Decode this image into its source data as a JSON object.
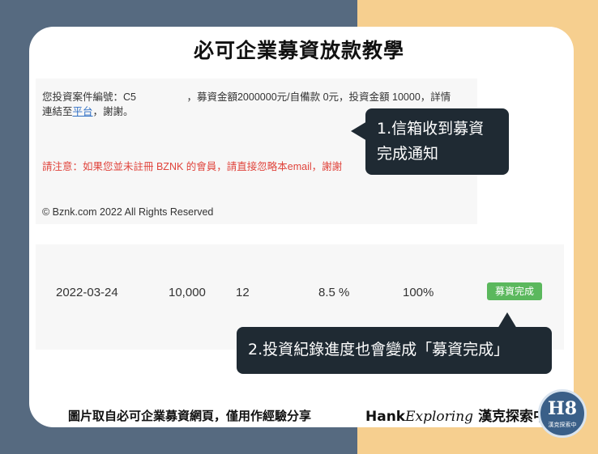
{
  "title": "必可企業募資放款教學",
  "email": {
    "line1": "您投資案件編號：C5　　　　　，募資金額2000000元/自備款 0元，投資金額 10000，詳情",
    "line2_prefix": "連結至",
    "line2_link": "平台",
    "line2_suffix": "，謝謝。",
    "notice": "請注意：如果您並未註冊 BZNK 的會員，請直接忽略本email，謝謝",
    "copyright": "© Bznk.com 2022 All Rights Reserved"
  },
  "record": {
    "date": "2022-03-24",
    "amount": "10,000",
    "months": "12",
    "rate": "8.5 %",
    "progress": "100%",
    "status": "募資完成",
    "status_color": "#5bb85d"
  },
  "callouts": {
    "first_line1": "1.信箱收到募資",
    "first_line2": "完成通知",
    "second": "2.投資紀錄進度也會變成「募資完成」"
  },
  "footer": {
    "credit": "圖片取自必可企業募資網頁，僅用作經驗分享",
    "brand_bold": "Hank",
    "brand_script": "Exploring",
    "brand_cn": "漢克探索中",
    "logo_mark": "H8",
    "logo_sub": "漢克探索中"
  },
  "colors": {
    "left_bg": "#566a80",
    "right_bg": "#f6cf8f",
    "callout_bg": "#1f2a33",
    "link": "#2f6fc4",
    "notice": "#e0443c"
  }
}
